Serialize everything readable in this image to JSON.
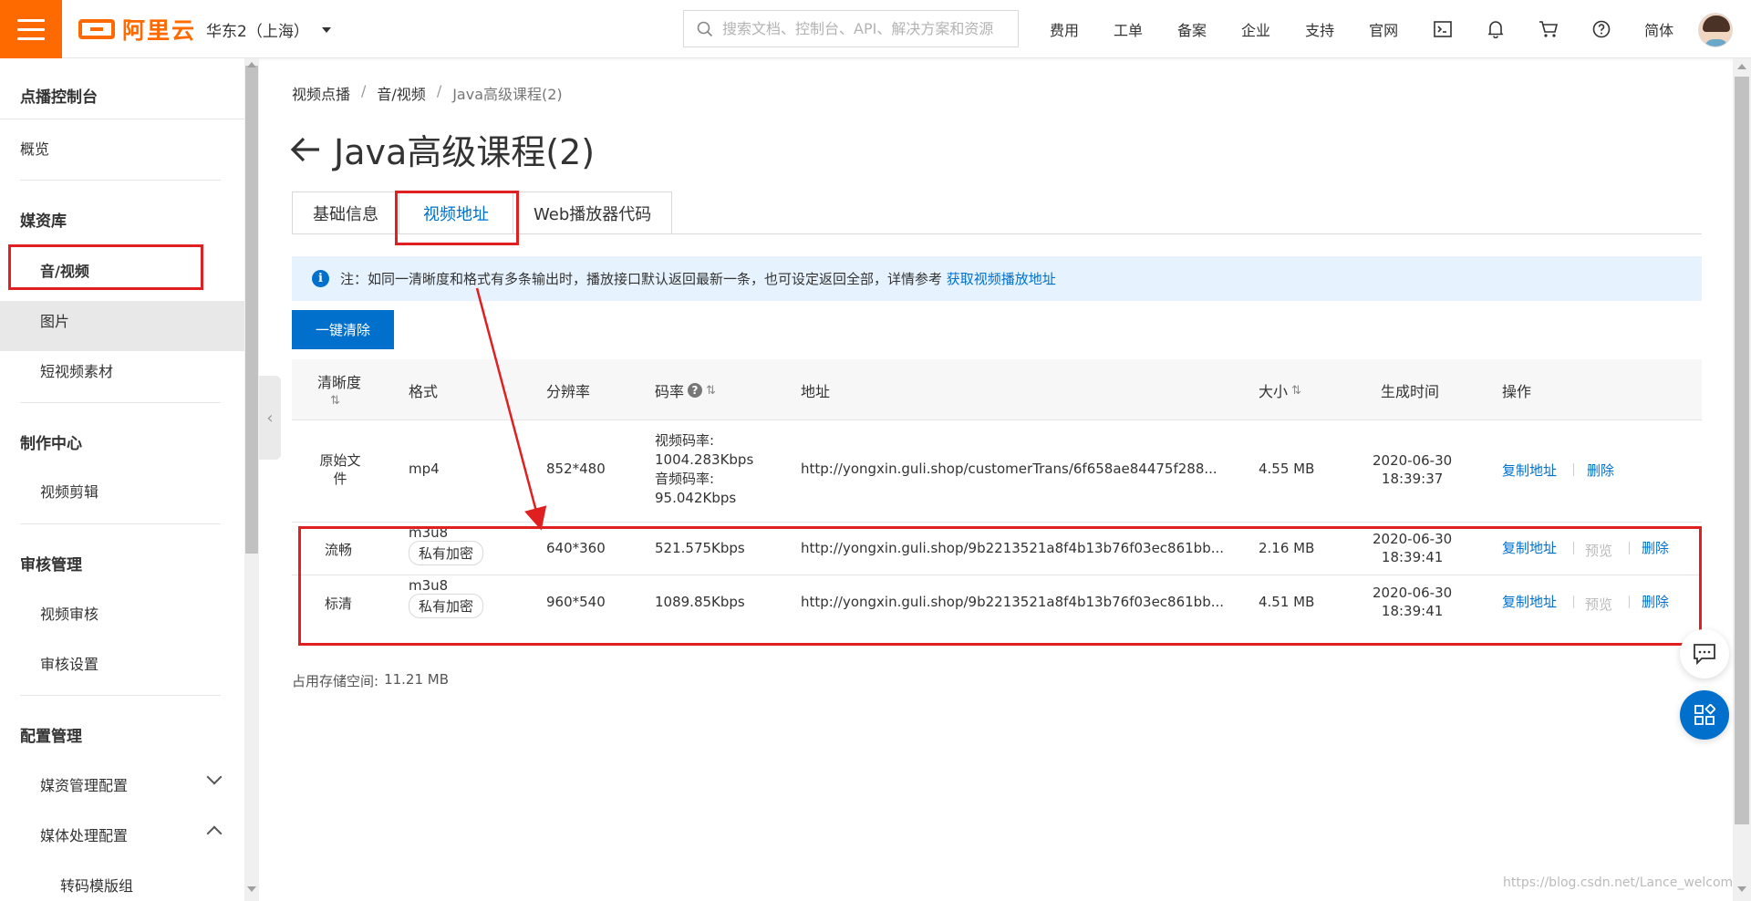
{
  "header": {
    "logo_text": "阿里云",
    "region": "华东2（上海）",
    "search_placeholder": "搜索文档、控制台、API、解决方案和资源",
    "nav": [
      "费用",
      "工单",
      "备案",
      "企业",
      "支持",
      "官网"
    ],
    "lang": "简体",
    "brand_color": "#ff6a00"
  },
  "sidebar": {
    "console_title": "点播控制台",
    "overview": "概览",
    "media_library": "媒资库",
    "audio_video": "音/视频",
    "images": "图片",
    "short_video": "短视频素材",
    "production_center": "制作中心",
    "video_editing": "视频剪辑",
    "review_mgmt": "审核管理",
    "video_review": "视频审核",
    "review_settings": "审核设置",
    "config_mgmt": "配置管理",
    "media_config": "媒资管理配置",
    "media_processing": "媒体处理配置",
    "transcode_group": "转码模版组"
  },
  "breadcrumb": [
    "视频点播",
    "音/视频",
    "Java高级课程(2)"
  ],
  "page_title": "Java高级课程(2)",
  "tabs": [
    "基础信息",
    "视频地址",
    "Web播放器代码"
  ],
  "active_tab": "视频地址",
  "notice": {
    "text": "注：如同一清晰度和格式有多条输出时，播放接口默认返回最新一条，也可设定返回全部，详情参考",
    "link": "获取视频播放地址"
  },
  "clear_button": "一键清除",
  "table": {
    "headers": {
      "definition": "清晰度",
      "format": "格式",
      "resolution": "分辨率",
      "bitrate": "码率",
      "url": "地址",
      "size": "大小",
      "created": "生成时间",
      "actions": "操作"
    },
    "rows": [
      {
        "definition": "原始文件",
        "format": "mp4",
        "tag": "",
        "resolution": "852*480",
        "bitrate_video": "视频码率:",
        "bitrate_video_val": "1004.283Kbps",
        "bitrate_audio": "音频码率:",
        "bitrate_audio_val": "95.042Kbps",
        "url": "http://yongxin.guli.shop/customerTrans/6f658ae84475f288...",
        "size": "4.55 MB",
        "date": "2020-06-30",
        "time": "18:39:37",
        "copy": "复制地址",
        "delete": "删除"
      },
      {
        "definition": "流畅",
        "format": "m3u8",
        "tag": "私有加密",
        "resolution": "640*360",
        "bitrate": "521.575Kbps",
        "url": "http://yongxin.guli.shop/9b2213521a8f4b13b76f03ec861bb...",
        "size": "2.16 MB",
        "date": "2020-06-30",
        "time": "18:39:41",
        "copy": "复制地址",
        "preview": "预览",
        "delete": "删除"
      },
      {
        "definition": "标清",
        "format": "m3u8",
        "tag": "私有加密",
        "resolution": "960*540",
        "bitrate": "1089.85Kbps",
        "url": "http://yongxin.guli.shop/9b2213521a8f4b13b76f03ec861bb...",
        "size": "4.51 MB",
        "date": "2020-06-30",
        "time": "18:39:41",
        "copy": "复制地址",
        "preview": "预览",
        "delete": "删除"
      }
    ]
  },
  "storage": {
    "label": "占用存储空间:",
    "value": "11.21 MB"
  },
  "watermark": "https://blog.csdn.net/Lance_welcom",
  "accent_color": "#0070cc",
  "annotation_color": "#e02020"
}
